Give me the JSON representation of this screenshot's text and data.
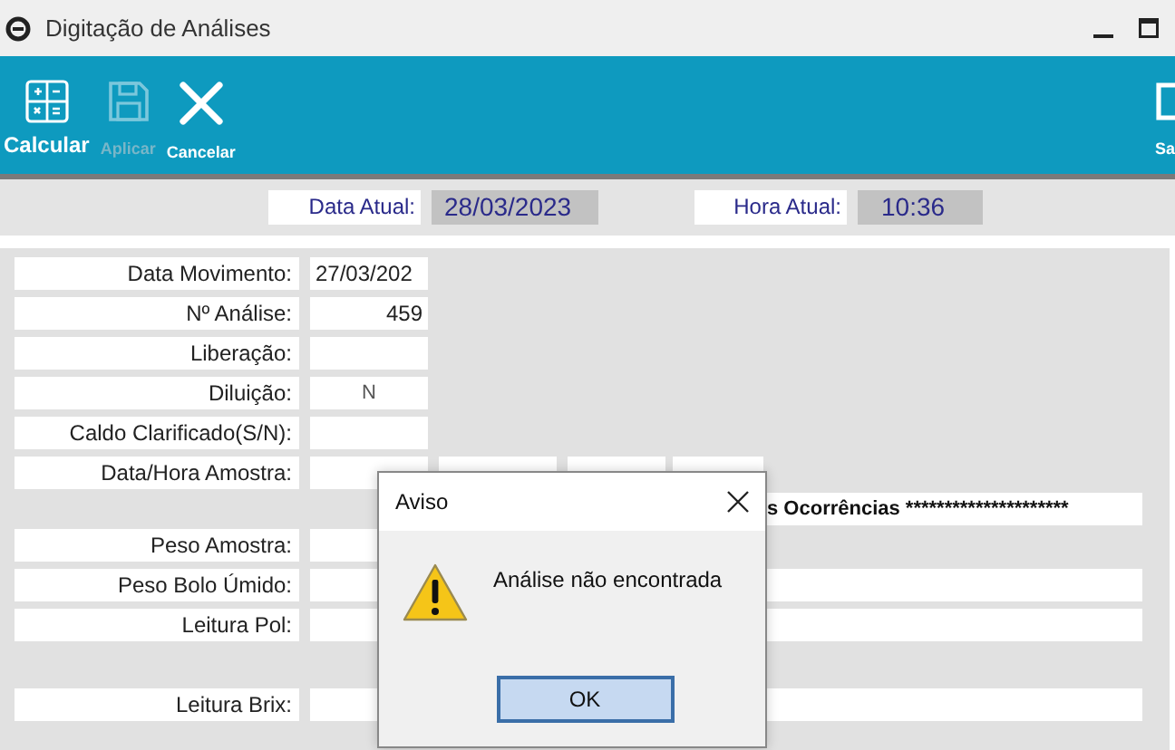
{
  "window": {
    "title": "Digitação de Análises"
  },
  "toolbar": [
    {
      "kind": "calculator",
      "label": "Calcular",
      "emphasized": true,
      "disabled": false
    },
    {
      "kind": "save",
      "label": "Aplicar",
      "emphasized": false,
      "disabled": true
    },
    {
      "kind": "cancel",
      "label": "Cancelar",
      "emphasized": false,
      "disabled": false
    },
    {
      "kind": "exit",
      "label": "Sa",
      "emphasized": false,
      "disabled": false
    }
  ],
  "header": {
    "date_label": "Data Atual:",
    "date": "28/03/2023",
    "time_label": "Hora Atual:",
    "time": "10:36"
  },
  "form": {
    "rows": [
      {
        "kind": "field",
        "label": "Data Movimento:",
        "field": {
          "kind": "text",
          "value": "27/03/202"
        }
      },
      {
        "kind": "field",
        "label": "Nº Análise:",
        "field": {
          "kind": "number",
          "value": "459"
        }
      },
      {
        "kind": "field",
        "label": "Liberação:"
      },
      {
        "kind": "field",
        "label": "Diluição:",
        "field": {
          "kind": "flag",
          "value": "N"
        }
      },
      {
        "kind": "field",
        "label": "Caldo Clarificado(S/N):"
      },
      {
        "kind": "datetime",
        "label": "Data/Hora Amostra:"
      },
      {
        "kind": "banner",
        "text": "s Ocorrências *********************"
      },
      {
        "kind": "field",
        "label": "Peso Amostra:"
      },
      {
        "kind": "wide",
        "label": "Peso Bolo Úmido:"
      },
      {
        "kind": "wide",
        "label": "Leitura Pol:"
      },
      {
        "kind": "wide",
        "label": "Leitura Brix:"
      }
    ]
  },
  "dialog": {
    "title": "Aviso",
    "message": "Análise não encontrada",
    "button": "OK"
  }
}
